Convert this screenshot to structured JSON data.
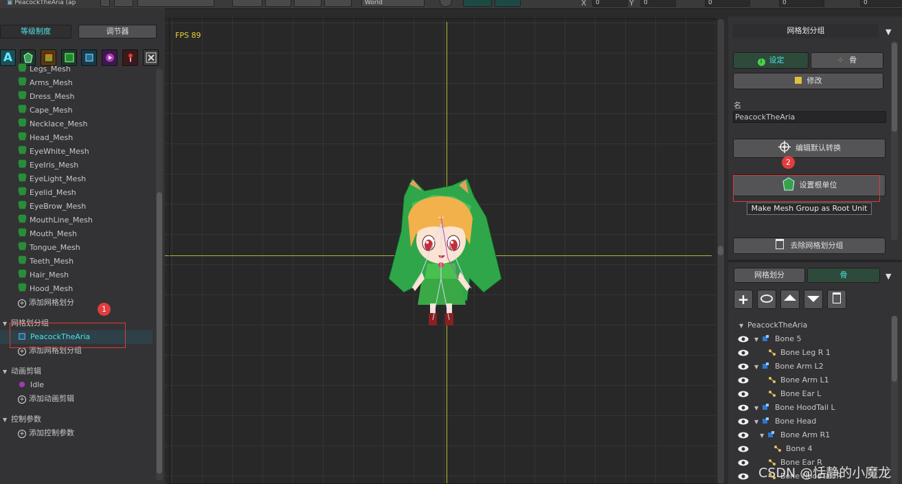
{
  "topbar": {
    "doc_name": "PeacockTheAria (ap",
    "dropdown_value": "World",
    "x_label": "X",
    "y_label": "Y",
    "x_value": "0",
    "y_value": "0",
    "field3": "0",
    "field4": "0",
    "field5": "0"
  },
  "left": {
    "tab_active": "等级制度",
    "tab_inactive": "调节器",
    "meshes": [
      "Legs_Mesh",
      "Arms_Mesh",
      "Dress_Mesh",
      "Cape_Mesh",
      "Necklace_Mesh",
      "Head_Mesh",
      "EyeWhite_Mesh",
      "EyeIris_Mesh",
      "EyeLight_Mesh",
      "Eyelid_Mesh",
      "EyeBrow_Mesh",
      "MouthLine_Mesh",
      "Mouth_Mesh",
      "Tongue_Mesh",
      "Teeth_Mesh",
      "Hair_Mesh",
      "Hood_Mesh"
    ],
    "add_mesh": "添加网格划分",
    "group_header": "网格划分组",
    "group_item": "PeacockTheAria",
    "add_group": "添加网格划分组",
    "anim_header": "动画剪辑",
    "anim_item": "Idle",
    "add_anim": "添加动画剪辑",
    "param_header": "控制参数",
    "add_param": "添加控制参数",
    "toolbar_icons": [
      "text-icon",
      "mesh-icon",
      "image-icon",
      "bone-icon",
      "group-icon",
      "play-icon",
      "param-icon",
      "close-box-icon"
    ]
  },
  "viewport": {
    "fps": "FPS 89"
  },
  "right": {
    "title": "网格划分组",
    "btn_setting": "设定",
    "btn_bone": "骨",
    "btn_modify": "修改",
    "name_label": "名",
    "name_value": "PeacockTheAria",
    "btn_edit_transform": "编辑默认转换",
    "btn_set_root": "设置根单位",
    "tooltip": "Make Mesh Group as Root Unit",
    "btn_remove": "去除网格划分组",
    "tab_mesh": "网格划分",
    "tab_bone": "骨",
    "bone_root": "PeacockTheAria",
    "bones": [
      "Bone 5",
      "Bone Leg R 1",
      "Bone Arm L2",
      "Bone Arm L1",
      "Bone Ear L",
      "Bone HoodTail L",
      "Bone Head",
      "Bone Arm R1",
      "Bone 4",
      "Bone Ear R",
      "Bone HoodTail R"
    ]
  },
  "annotations": {
    "badge1": "1",
    "badge2": "2"
  },
  "watermark": "CSDN @恬静的小魔龙",
  "colors": {
    "accent_cyan": "#4ee0e6",
    "highlight_red": "#e03b3b",
    "guide_yellow": "#c8c83a"
  }
}
